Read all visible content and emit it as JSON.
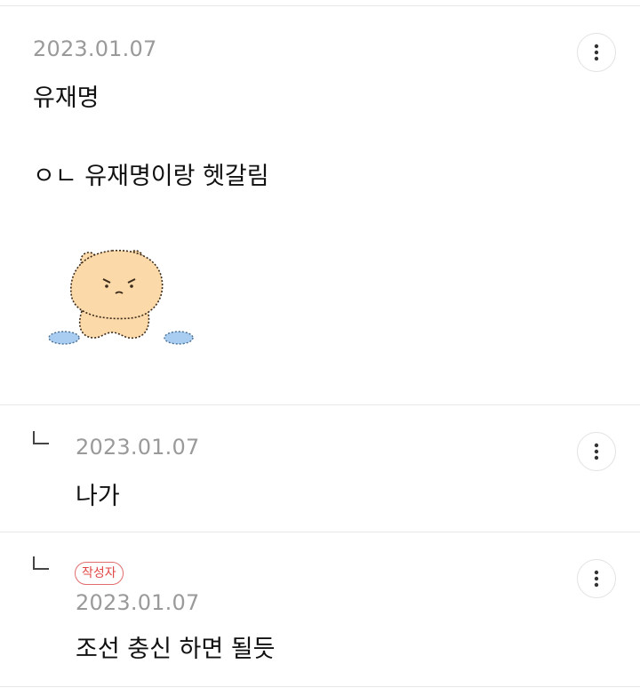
{
  "comments": [
    {
      "date": "2023.01.07",
      "lines": [
        "유재명",
        "ㅇㄴ 유재명이랑 헷갈림"
      ],
      "sticker": "fluffy-bear-sticker",
      "more_icon": "more-vertical-icon"
    },
    {
      "reply_icon": "reply-arrow-icon",
      "date": "2023.01.07",
      "text": "나가",
      "more_icon": "more-vertical-icon"
    },
    {
      "reply_icon": "reply-arrow-icon",
      "badge": "작성자",
      "date": "2023.01.07",
      "text": "조선 충신 하면 될듯",
      "more_icon": "more-vertical-icon"
    }
  ],
  "colors": {
    "date": "#9a9a9a",
    "badge": "#e24747",
    "divider": "#e7e7e7",
    "sticker_body": "#fbd9a8",
    "sticker_slipper": "#a9cdf0"
  }
}
